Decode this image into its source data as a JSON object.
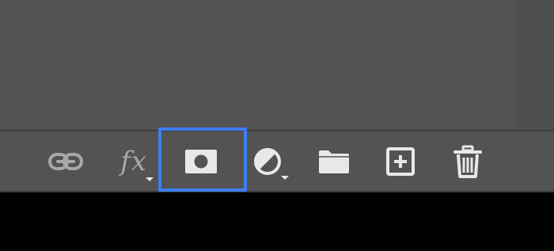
{
  "panel": {
    "footer": {
      "tools": [
        {
          "name": "link-layers",
          "icon": "link-icon",
          "has_menu": false,
          "state": "disabled"
        },
        {
          "name": "layer-style",
          "icon": "fx-icon",
          "label": "fx",
          "has_menu": true,
          "state": "disabled"
        },
        {
          "name": "add-mask",
          "icon": "mask-icon",
          "has_menu": false,
          "state": "highlighted"
        },
        {
          "name": "adjustment-layer",
          "icon": "half-circle-icon",
          "has_menu": true,
          "state": "enabled"
        },
        {
          "name": "new-group",
          "icon": "folder-icon",
          "has_menu": false,
          "state": "enabled"
        },
        {
          "name": "new-layer",
          "icon": "plus-square-icon",
          "has_menu": false,
          "state": "enabled"
        },
        {
          "name": "delete-layer",
          "icon": "trash-icon",
          "has_menu": false,
          "state": "enabled"
        }
      ]
    }
  },
  "colors": {
    "panel_bg": "#535353",
    "icon_enabled": "#e8e8e8",
    "icon_disabled": "#a8a8a8",
    "highlight": "#3d7ef5"
  }
}
